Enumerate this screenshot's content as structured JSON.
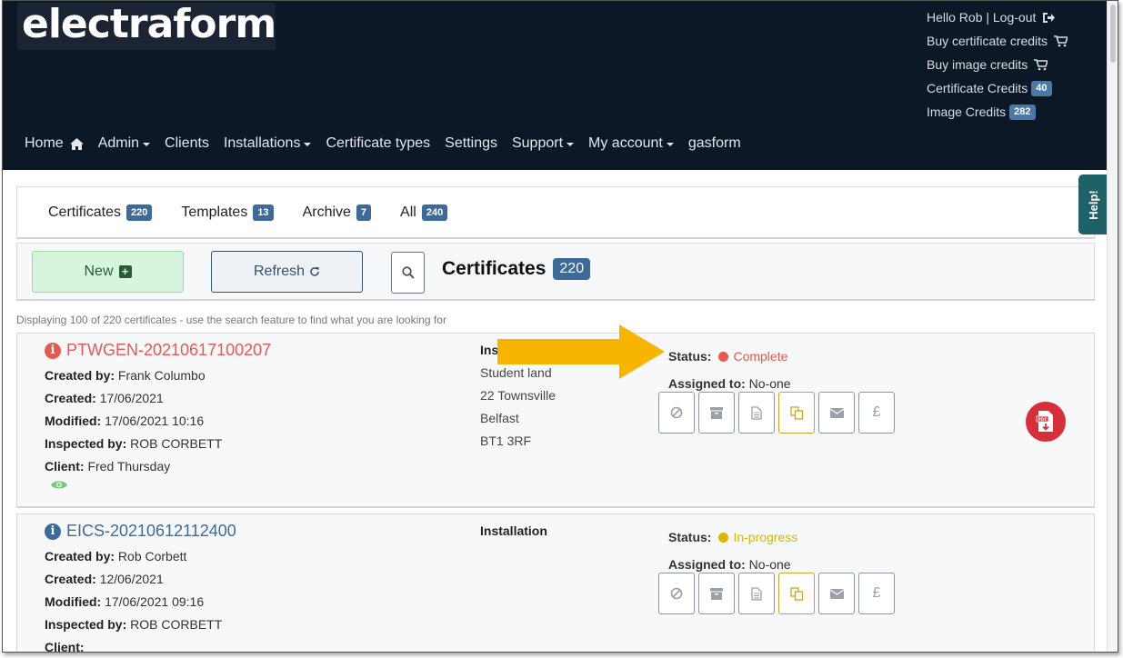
{
  "brand": {
    "logo_text": "electraform"
  },
  "user": {
    "greeting": "Hello Rob | Log-out",
    "buy_cert_credits": "Buy certificate credits",
    "buy_image_credits": "Buy image credits",
    "cert_credits_label": "Certificate Credits",
    "cert_credits_count": "40",
    "image_credits_label": "Image Credits",
    "image_credits_count": "282"
  },
  "nav": {
    "home": "Home",
    "admin": "Admin",
    "clients": "Clients",
    "installations": "Installations",
    "cert_types": "Certificate types",
    "settings": "Settings",
    "support": "Support",
    "my_account": "My account",
    "gasform": "gasform"
  },
  "help_label": "Help!",
  "tabs": [
    {
      "label": "Certificates",
      "count": "220"
    },
    {
      "label": "Templates",
      "count": "13"
    },
    {
      "label": "Archive",
      "count": "7"
    },
    {
      "label": "All",
      "count": "240"
    }
  ],
  "toolbar": {
    "new_label": "New",
    "refresh_label": "Refresh",
    "title": "Certificates",
    "count": "220"
  },
  "displaying_text": "Displaying 100 of 220 certificates - use the search feature to find what you are looking for",
  "labels": {
    "created_by": "Created by:",
    "created": "Created:",
    "modified": "Modified:",
    "inspected_by": "Inspected by:",
    "client": "Client:",
    "status": "Status:",
    "assigned_to": "Assigned to:"
  },
  "certificates": [
    {
      "id": "PTWGEN-20210617100207",
      "created_by": "Frank Columbo",
      "created": "17/06/2021",
      "modified": "17/06/2021 10:16",
      "inspected_by": "ROB CORBETT",
      "client": "Fred Thursday",
      "installation_label": "Ins",
      "address": [
        "Student land",
        "22 Townsville",
        "Belfast",
        "BT1 3RF"
      ],
      "status": "Complete",
      "assigned_to": "No-one"
    },
    {
      "id": "EICS-20210612112400",
      "created_by": "Rob Corbett",
      "created": "12/06/2021",
      "modified": "17/06/2021 09:16",
      "inspected_by": "ROB CORBETT",
      "client": "",
      "installation_label": "Installation",
      "status": "In-progress",
      "assigned_to": "No-one"
    }
  ],
  "colors": {
    "header_bg": "#0d1826",
    "complete": "#e8584f",
    "in_progress": "#d9b800",
    "badge": "#3d6a98",
    "arrow": "#f7b500",
    "link_red": "#e8584f",
    "link_blue": "#3d6a98"
  },
  "icons": {
    "logout": "sign-out-icon",
    "cart": "cart-icon",
    "home": "home-icon",
    "search": "search-icon",
    "refresh": "refresh-icon",
    "plus": "plus-square-icon",
    "view": "eye-icon",
    "actions": [
      "ban-icon",
      "archive-icon",
      "document-icon",
      "copy-icon",
      "envelope-icon",
      "pound-icon"
    ],
    "pdf": "pdf-download-icon"
  }
}
